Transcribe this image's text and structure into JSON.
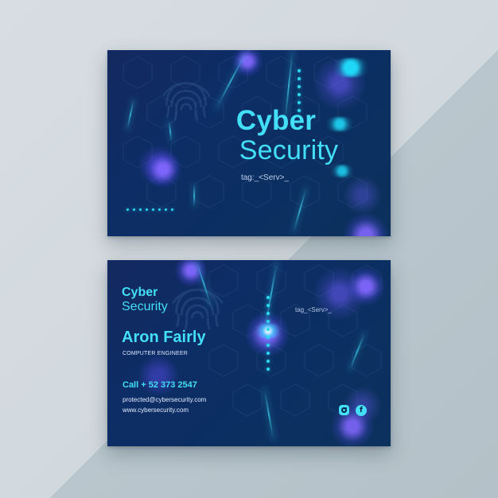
{
  "front": {
    "title_line_1": "Cyber",
    "title_line_2": "Security",
    "tag": "tag:_<Serv>_"
  },
  "back": {
    "logo_line_1": "Cyber",
    "logo_line_2": "Security",
    "tag": "tag_<Serv>_",
    "name": "Aron Fairly",
    "role": "COMPUTER ENGINEER",
    "phone": "Call + 52 373 2547",
    "email": "protected@cybersecurity.com",
    "website": "www.cybersecurity.com",
    "social_icons": [
      "instagram-icon",
      "facebook-icon"
    ]
  },
  "colors": {
    "accent": "#43dff7",
    "card_dark": "#0d2d66",
    "card_light": "#13295f",
    "glow": "#6f5bff"
  }
}
